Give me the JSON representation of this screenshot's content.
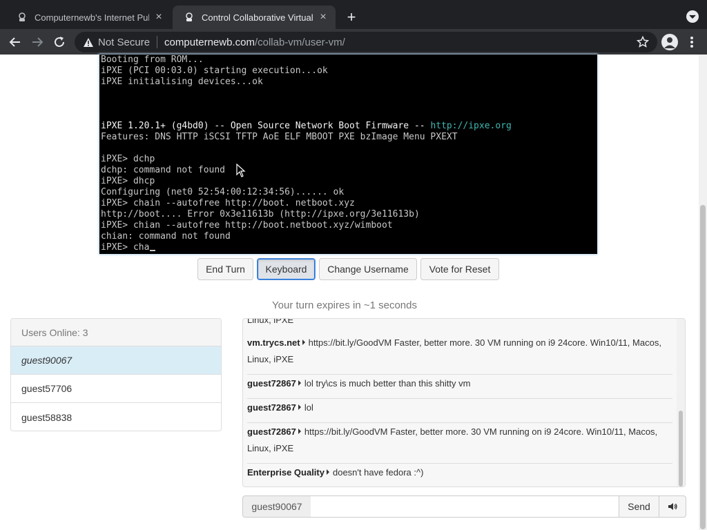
{
  "browser": {
    "tabs": [
      {
        "title": "Computernewb's Internet Pub",
        "active": false
      },
      {
        "title": "Control Collaborative Virtual M",
        "active": true
      }
    ],
    "security_label": "Not Secure",
    "url_host": "computernewb.com",
    "url_path": "/collab-vm/user-vm/"
  },
  "vm": {
    "lines": [
      {
        "text": "Booting from ROM...",
        "bright": false
      },
      {
        "text": "iPXE (PCI 00:03.0) starting execution...ok",
        "bright": false
      },
      {
        "text": "iPXE initialising devices...ok",
        "bright": false
      },
      {
        "text": "",
        "bright": false
      },
      {
        "text": "",
        "bright": false
      },
      {
        "text": "",
        "bright": false
      },
      {
        "text": "iPXE 1.20.1+ (g4bd0) -- Open Source Network Boot Firmware -- ",
        "bright": true,
        "link": "http://ipxe.org"
      },
      {
        "text": "Features: DNS HTTP iSCSI TFTP AoE ELF MBOOT PXE bzImage Menu PXEXT",
        "bright": false
      },
      {
        "text": "",
        "bright": false
      },
      {
        "text": "iPXE> dchp",
        "bright": false
      },
      {
        "text": "dchp: command not found",
        "bright": false
      },
      {
        "text": "iPXE> dhcp",
        "bright": false
      },
      {
        "text": "Configuring (net0 52:54:00:12:34:56)...... ok",
        "bright": false
      },
      {
        "text": "iPXE> chain --autofree http://boot. netboot.xyz",
        "bright": false
      },
      {
        "text": "http://boot.... Error 0x3e11613b (http://ipxe.org/3e11613b)",
        "bright": false
      },
      {
        "text": "iPXE> chian --autofree http://boot.netboot.xyz/wimboot",
        "bright": false
      },
      {
        "text": "chian: command not found",
        "bright": false
      },
      {
        "text": "iPXE> cha",
        "bright": false,
        "cursor": true
      }
    ]
  },
  "controls": {
    "end_turn": "End Turn",
    "keyboard": "Keyboard",
    "change_username": "Change Username",
    "vote_reset": "Vote for Reset"
  },
  "turn_status": "Your turn expires in ~1 seconds",
  "users": {
    "header": "Users Online: 3",
    "list": [
      "guest90067",
      "guest57706",
      "guest58838"
    ]
  },
  "chat": {
    "partial_top": "Linux, iPXE",
    "messages": [
      {
        "user": "vm.trycs.net",
        "text": "https://bit.ly/GoodVM Faster, better more. 30 VM running on i9 24core. Win10/11, Macos, Linux, iPXE"
      },
      {
        "user": "guest72867",
        "text": "lol try\\cs is much better than this shitty vm"
      },
      {
        "user": "guest72867",
        "text": "lol"
      },
      {
        "user": "guest72867",
        "text": "https://bit.ly/GoodVM Faster, better more. 30 VM running on i9 24core. Win10/11, Macos, Linux, iPXE"
      },
      {
        "user": "Enterprise Quality",
        "text": "doesn't have fedora :^)"
      }
    ],
    "username": "guest90067",
    "input_value": "",
    "send": "Send"
  },
  "colors": {
    "selected_user": "#d9edf7",
    "vm_link": "#3fb7b0",
    "focus_ring": "#1a73e8"
  }
}
